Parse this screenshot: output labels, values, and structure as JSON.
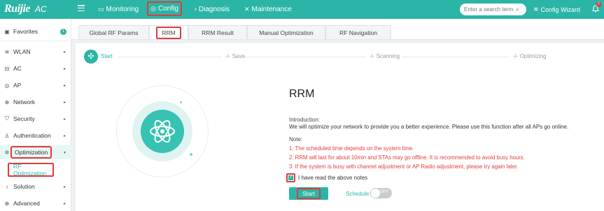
{
  "app": {
    "brand": "Ruijie",
    "product": "AC"
  },
  "topnav": {
    "items": [
      {
        "label": "Monitoring",
        "icon": "monitor-icon"
      },
      {
        "label": "Config",
        "icon": "config-gear-icon"
      },
      {
        "label": "Diagnosis",
        "icon": "diagnosis-icon"
      },
      {
        "label": "Maintenance",
        "icon": "maintenance-icon"
      }
    ],
    "search_placeholder": "Enter a search term",
    "config_wizard": "Config Wizard",
    "notification_count": "2"
  },
  "sidebar": {
    "favorites": {
      "label": "Favorites",
      "count": "1"
    },
    "items": [
      {
        "label": "WLAN"
      },
      {
        "label": "AC"
      },
      {
        "label": "AP"
      },
      {
        "label": "Network"
      },
      {
        "label": "Security"
      },
      {
        "label": "Authentication"
      },
      {
        "label": "Optimization"
      },
      {
        "label": "Solution"
      },
      {
        "label": "Advanced"
      }
    ],
    "sub_item": "RF Optimization"
  },
  "tabs": [
    {
      "label": "Global RF Params"
    },
    {
      "label": "RRM"
    },
    {
      "label": "RRM Result"
    },
    {
      "label": "Manual Optimization"
    },
    {
      "label": "RF Navigation"
    }
  ],
  "steps": [
    {
      "label": "Start"
    },
    {
      "label": "Save"
    },
    {
      "label": "Scanning"
    },
    {
      "label": "Optimizing"
    }
  ],
  "main": {
    "title": "RRM",
    "intro_heading": "Introduction:",
    "intro_text": "We will optimize your network to provide you a better experience. Please use this function after all APs go online.",
    "note_heading": "Note:",
    "notes": [
      "1. The scheduled time depends on the system time.",
      "2. RRM will last for about 10min and STAs may go offline. It is recommended to avoid busy hours.",
      "3. If the system is busy with channel adjustment or AP Radio adjustment, please try again later."
    ],
    "checkbox_label": "I have read the above notes",
    "start_label": "Start",
    "schedule_label": "Schedule:",
    "schedule_state": "OFF"
  },
  "colors": {
    "accent": "#2bb5a6",
    "highlight": "#e03b3b",
    "note": "#e23d3d"
  }
}
